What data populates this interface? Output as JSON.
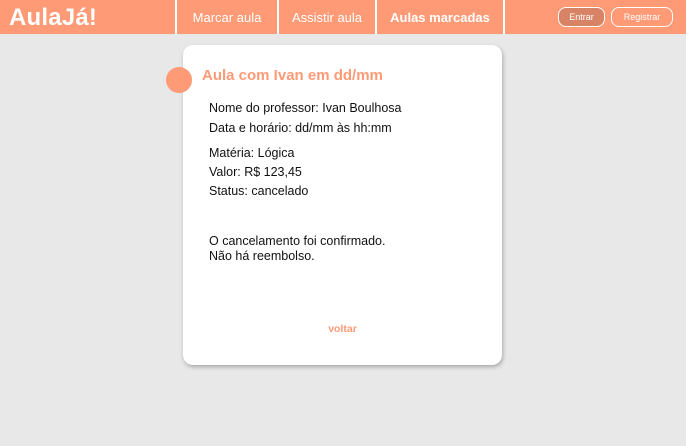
{
  "header": {
    "logo": "AulaJá!",
    "nav": [
      "Marcar aula",
      "Assistir aula",
      "Aulas marcadas"
    ],
    "login_label": "Entrar",
    "register_label": "Registrar"
  },
  "card": {
    "title": "Aula com Ivan em dd/mm",
    "teacher": "Nome do professor: Ivan Boulhosa",
    "datetime": "Data e horário: dd/mm às hh:mm",
    "subject": "Matéria: Lógica",
    "price": "Valor: R$ 123,45",
    "status": "Status: cancelado",
    "message_line1": "O cancelamento foi confirmado.",
    "message_line2": "Não há reembolso.",
    "back_label": "voltar"
  },
  "colors": {
    "accent": "#ff9a76",
    "background": "#e8e8e8",
    "card": "#ffffff"
  }
}
